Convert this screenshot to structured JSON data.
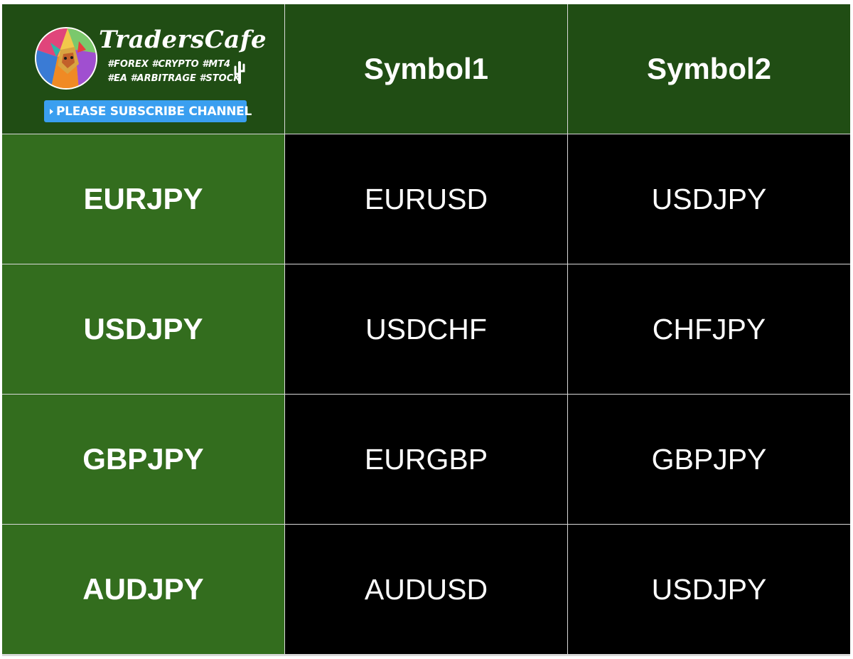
{
  "logo": {
    "brand": "TradersCafe",
    "tags_line1": "#FOREX #CRYPTO #MT4",
    "tags_line2": "#EA #ARBITRAGE #STOCK",
    "subscribe_label": "PLEASE SUBSCRIBE CHANNEL",
    "icons": [
      "lion-avatar-icon",
      "cactus-icon",
      "play-icon"
    ]
  },
  "colors": {
    "header_bg": "#204d14",
    "row_header_bg": "#336d1e",
    "value_bg": "#000000",
    "grid_line": "#d9d9d9",
    "subscribe_bg": "#3a9ff0"
  },
  "table": {
    "columns": [
      "Symbol1",
      "Symbol2"
    ],
    "rows": [
      {
        "label": "EURJPY",
        "symbol1": "EURUSD",
        "symbol2": "USDJPY"
      },
      {
        "label": "USDJPY",
        "symbol1": "USDCHF",
        "symbol2": "CHFJPY"
      },
      {
        "label": "GBPJPY",
        "symbol1": "EURGBP",
        "symbol2": "GBPJPY"
      },
      {
        "label": "AUDJPY",
        "symbol1": "AUDUSD",
        "symbol2": "USDJPY"
      }
    ]
  }
}
